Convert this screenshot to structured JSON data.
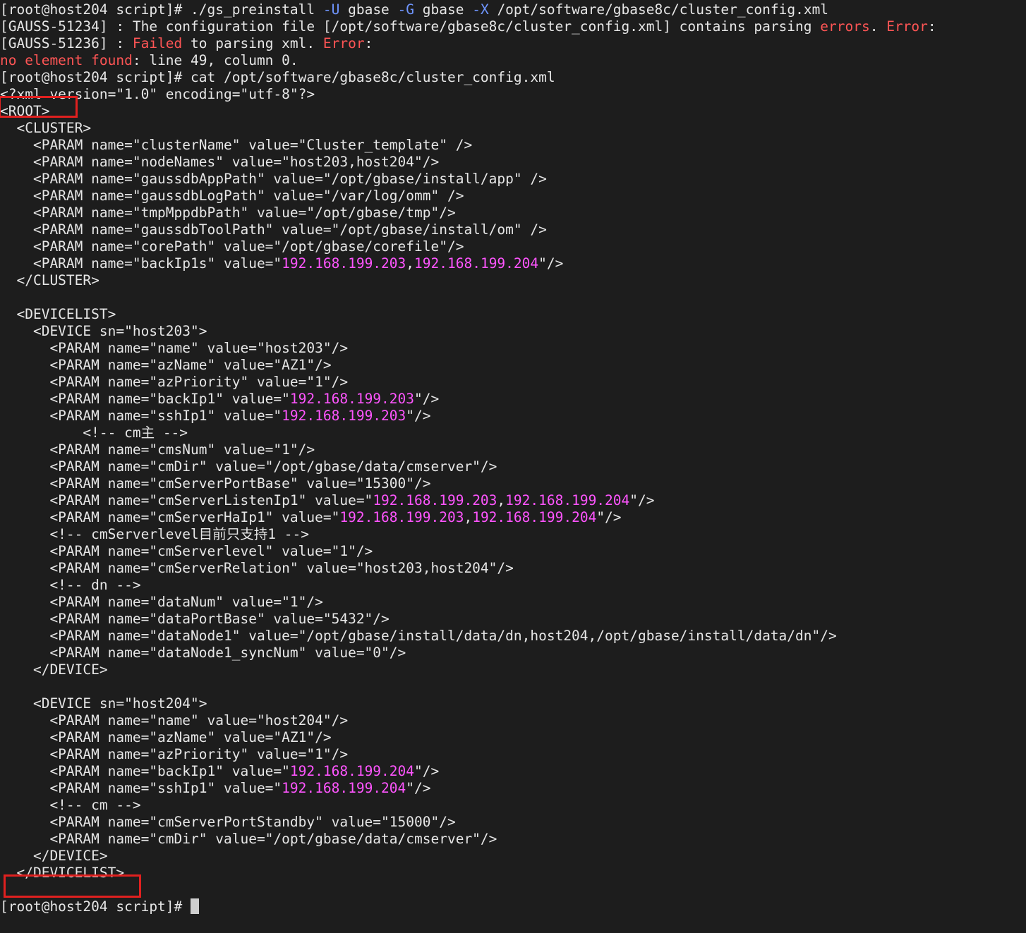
{
  "terminal": {
    "prompt": "[root@host204 script]#",
    "lines": [
      [
        {
          "t": "[root@host204 script]# ./gs_preinstall "
        },
        {
          "t": "-U",
          "c": "blue"
        },
        {
          "t": " gbase "
        },
        {
          "t": "-G",
          "c": "blue"
        },
        {
          "t": " gbase "
        },
        {
          "t": "-X",
          "c": "blue"
        },
        {
          "t": " /opt/software/gbase8c/cluster_config.xml"
        }
      ],
      [
        {
          "t": "[GAUSS-51234] : The configuration file [/opt/software/gbase8c/cluster_config.xml] contains parsing "
        },
        {
          "t": "errors",
          "c": "red"
        },
        {
          "t": ". "
        },
        {
          "t": "Error",
          "c": "red"
        },
        {
          "t": ":"
        }
      ],
      [
        {
          "t": "[GAUSS-51236] : "
        },
        {
          "t": "Failed",
          "c": "red"
        },
        {
          "t": " to parsing xml. "
        },
        {
          "t": "Error",
          "c": "red"
        },
        {
          "t": ":"
        }
      ],
      [
        {
          "t": "no element found",
          "c": "red"
        },
        {
          "t": ": line 49, column 0."
        }
      ],
      [
        {
          "t": "[root@host204 script]# cat /opt/software/gbase8c/cluster_config.xml"
        }
      ],
      [
        {
          "t": "<?xml version=\"1.0\" encoding=\"utf-8\"?>"
        }
      ],
      [
        {
          "t": "<ROOT>"
        }
      ],
      [
        {
          "t": "  <CLUSTER>"
        }
      ],
      [
        {
          "t": "    <PARAM name=\"clusterName\" value=\"Cluster_template\" />"
        }
      ],
      [
        {
          "t": "    <PARAM name=\"nodeNames\" value=\"host203,host204\"/>"
        }
      ],
      [
        {
          "t": "    <PARAM name=\"gaussdbAppPath\" value=\"/opt/gbase/install/app\" />"
        }
      ],
      [
        {
          "t": "    <PARAM name=\"gaussdbLogPath\" value=\"/var/log/omm\" />"
        }
      ],
      [
        {
          "t": "    <PARAM name=\"tmpMppdbPath\" value=\"/opt/gbase/tmp\"/>"
        }
      ],
      [
        {
          "t": "    <PARAM name=\"gaussdbToolPath\" value=\"/opt/gbase/install/om\" />"
        }
      ],
      [
        {
          "t": "    <PARAM name=\"corePath\" value=\"/opt/gbase/corefile\"/>"
        }
      ],
      [
        {
          "t": "    <PARAM name=\"backIp1s\" value=\""
        },
        {
          "t": "192.168.199.203",
          "c": "magenta"
        },
        {
          "t": ","
        },
        {
          "t": "192.168.199.204",
          "c": "magenta"
        },
        {
          "t": "\"/>"
        }
      ],
      [
        {
          "t": "  </CLUSTER>"
        }
      ],
      [
        {
          "t": ""
        }
      ],
      [
        {
          "t": "  <DEVICELIST>"
        }
      ],
      [
        {
          "t": "    <DEVICE sn=\"host203\">"
        }
      ],
      [
        {
          "t": "      <PARAM name=\"name\" value=\"host203\"/>"
        }
      ],
      [
        {
          "t": "      <PARAM name=\"azName\" value=\"AZ1\"/>"
        }
      ],
      [
        {
          "t": "      <PARAM name=\"azPriority\" value=\"1\"/>"
        }
      ],
      [
        {
          "t": "      <PARAM name=\"backIp1\" value=\""
        },
        {
          "t": "192.168.199.203",
          "c": "magenta"
        },
        {
          "t": "\"/>"
        }
      ],
      [
        {
          "t": "      <PARAM name=\"sshIp1\" value=\""
        },
        {
          "t": "192.168.199.203",
          "c": "magenta"
        },
        {
          "t": "\"/>"
        }
      ],
      [
        {
          "t": "          <!-- cm主 -->"
        }
      ],
      [
        {
          "t": "      <PARAM name=\"cmsNum\" value=\"1\"/>"
        }
      ],
      [
        {
          "t": "      <PARAM name=\"cmDir\" value=\"/opt/gbase/data/cmserver\"/>"
        }
      ],
      [
        {
          "t": "      <PARAM name=\"cmServerPortBase\" value=\"15300\"/>"
        }
      ],
      [
        {
          "t": "      <PARAM name=\"cmServerListenIp1\" value=\""
        },
        {
          "t": "192.168.199.203",
          "c": "magenta"
        },
        {
          "t": ","
        },
        {
          "t": "192.168.199.204",
          "c": "magenta"
        },
        {
          "t": "\"/>"
        }
      ],
      [
        {
          "t": "      <PARAM name=\"cmServerHaIp1\" value=\""
        },
        {
          "t": "192.168.199.203",
          "c": "magenta"
        },
        {
          "t": ","
        },
        {
          "t": "192.168.199.204",
          "c": "magenta"
        },
        {
          "t": "\"/>"
        }
      ],
      [
        {
          "t": "      <!-- cmServerlevel目前只支持1 -->"
        }
      ],
      [
        {
          "t": "      <PARAM name=\"cmServerlevel\" value=\"1\"/>"
        }
      ],
      [
        {
          "t": "      <PARAM name=\"cmServerRelation\" value=\"host203,host204\"/>"
        }
      ],
      [
        {
          "t": "      <!-- dn -->"
        }
      ],
      [
        {
          "t": "      <PARAM name=\"dataNum\" value=\"1\"/>"
        }
      ],
      [
        {
          "t": "      <PARAM name=\"dataPortBase\" value=\"5432\"/>"
        }
      ],
      [
        {
          "t": "      <PARAM name=\"dataNode1\" value=\"/opt/gbase/install/data/dn,host204,/opt/gbase/install/data/dn\"/>"
        }
      ],
      [
        {
          "t": "      <PARAM name=\"dataNode1_syncNum\" value=\"0\"/>"
        }
      ],
      [
        {
          "t": "    </DEVICE>"
        }
      ],
      [
        {
          "t": ""
        }
      ],
      [
        {
          "t": "    <DEVICE sn=\"host204\">"
        }
      ],
      [
        {
          "t": "      <PARAM name=\"name\" value=\"host204\"/>"
        }
      ],
      [
        {
          "t": "      <PARAM name=\"azName\" value=\"AZ1\"/>"
        }
      ],
      [
        {
          "t": "      <PARAM name=\"azPriority\" value=\"1\"/>"
        }
      ],
      [
        {
          "t": "      <PARAM name=\"backIp1\" value=\""
        },
        {
          "t": "192.168.199.204",
          "c": "magenta"
        },
        {
          "t": "\"/>"
        }
      ],
      [
        {
          "t": "      <PARAM name=\"sshIp1\" value=\""
        },
        {
          "t": "192.168.199.204",
          "c": "magenta"
        },
        {
          "t": "\"/>"
        }
      ],
      [
        {
          "t": "      <!-- cm -->"
        }
      ],
      [
        {
          "t": "      <PARAM name=\"cmServerPortStandby\" value=\"15000\"/>"
        }
      ],
      [
        {
          "t": "      <PARAM name=\"cmDir\" value=\"/opt/gbase/data/cmserver\"/>"
        }
      ],
      [
        {
          "t": "    </DEVICE>"
        }
      ],
      [
        {
          "t": "  </DEVICELIST>"
        }
      ],
      [
        {
          "t": ""
        }
      ]
    ]
  },
  "colors": {
    "background": "#1d1d1d",
    "text": "#e6e6e6",
    "red": "#ff5555",
    "magenta": "#ff55ff",
    "blue": "#6f95ff",
    "highlight_box": "#e0201f"
  }
}
